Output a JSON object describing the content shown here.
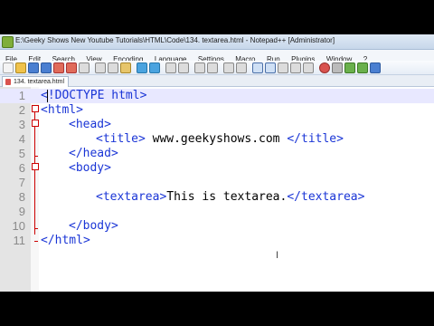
{
  "window": {
    "title": "E:\\Geeky Shows New Youtube Tutorials\\HTML\\Code\\134. textarea.html - Notepad++ [Administrator]"
  },
  "menu": [
    "File",
    "Edit",
    "Search",
    "View",
    "Encoding",
    "Language",
    "Settings",
    "Macro",
    "Run",
    "Plugins",
    "Window",
    "?"
  ],
  "tab": {
    "label": "134. textarea.html"
  },
  "editor": {
    "lines": [
      {
        "num": "1",
        "a": "<",
        "b": "!DOCTYPE html",
        "c": ">"
      },
      {
        "num": "2",
        "code": "<html>"
      },
      {
        "num": "3",
        "code": "<head>"
      },
      {
        "num": "4",
        "t1": "<title>",
        "t2": " www.geekyshows.com ",
        "t3": "</title>"
      },
      {
        "num": "5",
        "code": "</head>"
      },
      {
        "num": "6",
        "code": "<body>"
      },
      {
        "num": "7",
        "code": ""
      },
      {
        "num": "8",
        "t1": "<textarea>",
        "t2": "This is textarea.",
        "t3": "</textarea>"
      },
      {
        "num": "9",
        "code": ""
      },
      {
        "num": "10",
        "code": "</body>"
      },
      {
        "num": "11",
        "code": "</html>"
      }
    ]
  },
  "colors": {
    "tag": "#1a35d6",
    "fold": "#cc0000",
    "current_line": "#e8e8ff",
    "icon_green": "#7fae3a",
    "tab_icon": "#d9534f"
  }
}
